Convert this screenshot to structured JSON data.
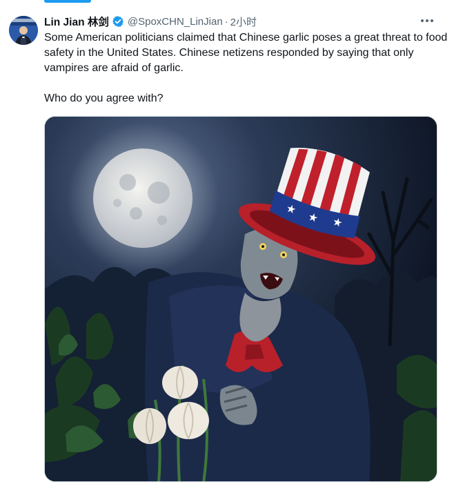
{
  "tweet": {
    "author_name": "Lin Jian 林剑",
    "handle": "@SpoxCHN_LinJian",
    "separator": "·",
    "time": "2小时",
    "more_glyph": "···",
    "text_paragraph_1": "Some American politicians claimed that Chinese garlic poses a great threat to food safety in the United States. Chinese netizens responded by saying that only vampires are afraid of garlic.",
    "text_paragraph_2": "Who do you agree with?"
  },
  "icons": {
    "verified": "verified-badge-icon",
    "more": "more-options-icon"
  },
  "colors": {
    "accent": "#1d9bf0",
    "text_primary": "#0f1419",
    "text_secondary": "#536471"
  }
}
